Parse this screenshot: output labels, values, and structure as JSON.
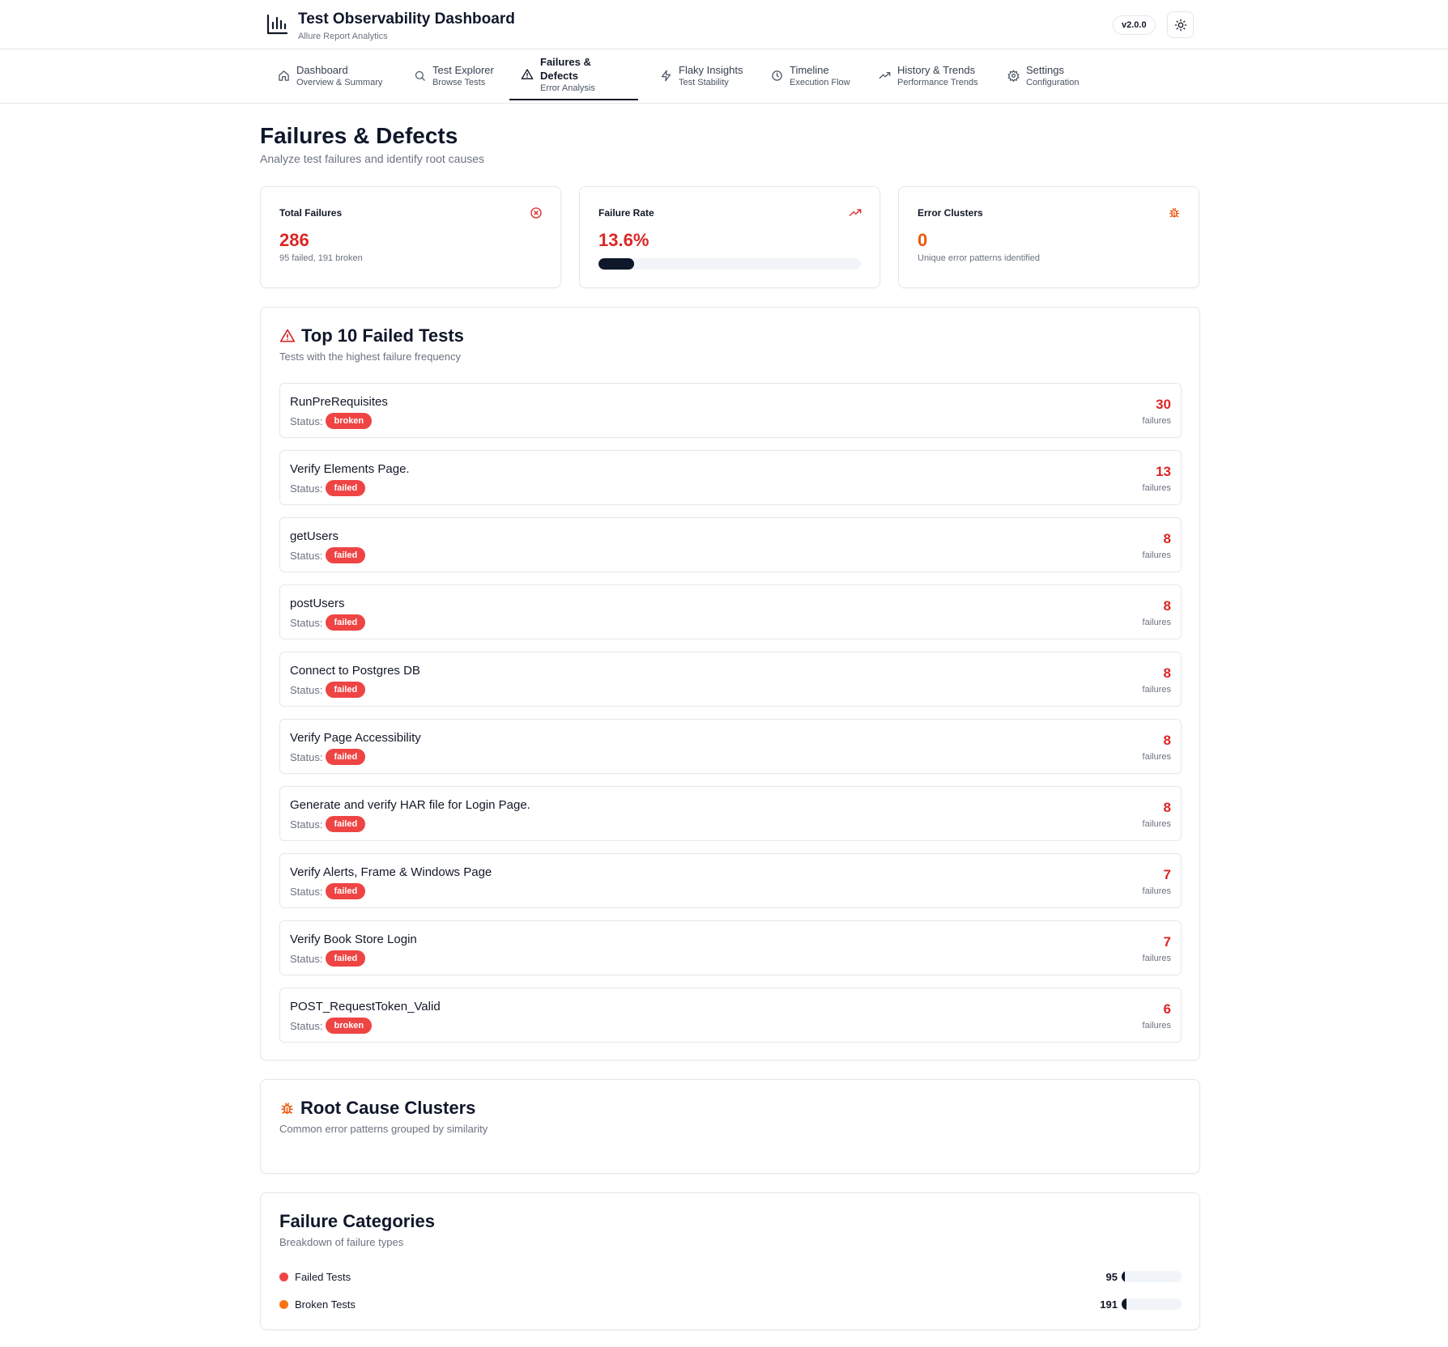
{
  "app": {
    "title": "Test Observability Dashboard",
    "subtitle": "Allure Report Analytics",
    "version": "v2.0.0"
  },
  "nav": [
    {
      "label": "Dashboard",
      "sub": "Overview & Summary",
      "icon": "home-icon"
    },
    {
      "label": "Test Explorer",
      "sub": "Browse Tests",
      "icon": "search-icon"
    },
    {
      "label": "Failures & Defects",
      "sub": "Error Analysis",
      "icon": "alert-triangle-icon",
      "active": true
    },
    {
      "label": "Flaky Insights",
      "sub": "Test Stability",
      "icon": "zap-icon"
    },
    {
      "label": "Timeline",
      "sub": "Execution Flow",
      "icon": "clock-icon"
    },
    {
      "label": "History & Trends",
      "sub": "Performance Trends",
      "icon": "trending-up-icon"
    },
    {
      "label": "Settings",
      "sub": "Configuration",
      "icon": "gear-icon"
    }
  ],
  "page": {
    "title": "Failures & Defects",
    "subtitle": "Analyze test failures and identify root causes"
  },
  "stats": {
    "total_failures": {
      "label": "Total Failures",
      "value": "286",
      "detail": "95 failed, 191 broken",
      "icon": "x-circle-icon"
    },
    "failure_rate": {
      "label": "Failure Rate",
      "value": "13.6%",
      "progress": 13.6,
      "icon": "trending-up-icon"
    },
    "error_clusters": {
      "label": "Error Clusters",
      "value": "0",
      "detail": "Unique error patterns identified",
      "icon": "bug-icon"
    }
  },
  "top_failed": {
    "title": "Top 10 Failed Tests",
    "subtitle": "Tests with the highest failure frequency",
    "status_label": "Status:",
    "unit": "failures",
    "items": [
      {
        "name": "RunPreRequisites",
        "status": "broken",
        "count": "30"
      },
      {
        "name": "Verify Elements Page.",
        "status": "failed",
        "count": "13"
      },
      {
        "name": "getUsers",
        "status": "failed",
        "count": "8"
      },
      {
        "name": "postUsers",
        "status": "failed",
        "count": "8"
      },
      {
        "name": "Connect to Postgres DB",
        "status": "failed",
        "count": "8"
      },
      {
        "name": "Verify Page Accessibility",
        "status": "failed",
        "count": "8"
      },
      {
        "name": "Generate and verify HAR file for Login Page.",
        "status": "failed",
        "count": "8"
      },
      {
        "name": "Verify Alerts, Frame & Windows Page",
        "status": "failed",
        "count": "7"
      },
      {
        "name": "Verify Book Store Login",
        "status": "failed",
        "count": "7"
      },
      {
        "name": "POST_RequestToken_Valid",
        "status": "broken",
        "count": "6"
      }
    ]
  },
  "root_cause": {
    "title": "Root Cause Clusters",
    "subtitle": "Common error patterns grouped by similarity"
  },
  "categories": {
    "title": "Failure Categories",
    "subtitle": "Breakdown of failure types",
    "items": [
      {
        "label": "Failed Tests",
        "count": "95",
        "color": "#ef4444",
        "fill": 0.05
      },
      {
        "label": "Broken Tests",
        "count": "191",
        "color": "#f97316",
        "fill": 0.08
      }
    ]
  },
  "colors": {
    "danger": "#dc2626",
    "badge": "#ef4444",
    "warning": "#ea580c",
    "primary": "#0f172a"
  }
}
